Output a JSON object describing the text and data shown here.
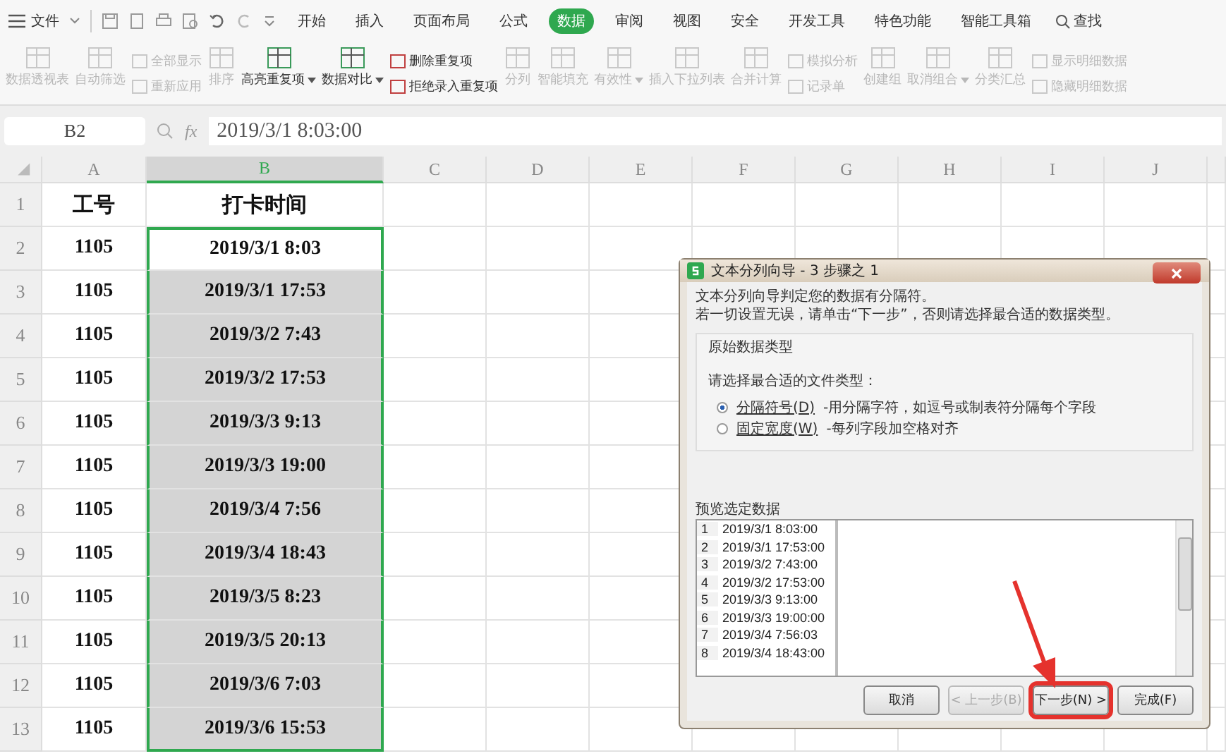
{
  "menu": {
    "file": "文件",
    "search": "查找",
    "tabs": [
      {
        "label": "开始",
        "selected": false
      },
      {
        "label": "插入",
        "selected": false
      },
      {
        "label": "页面布局",
        "selected": false
      },
      {
        "label": "公式",
        "selected": false
      },
      {
        "label": "数据",
        "selected": true
      },
      {
        "label": "审阅",
        "selected": false
      },
      {
        "label": "视图",
        "selected": false
      },
      {
        "label": "安全",
        "selected": false
      },
      {
        "label": "开发工具",
        "selected": false
      },
      {
        "label": "特色功能",
        "selected": false
      },
      {
        "label": "智能工具箱",
        "selected": false
      }
    ]
  },
  "ribbon": [
    {
      "kind": "big",
      "label": "数据透视表",
      "disabled": true,
      "dropdown": false
    },
    {
      "kind": "big",
      "label": "自动筛选",
      "disabled": true,
      "dropdown": false
    },
    {
      "kind": "small",
      "labels": [
        "全部显示",
        "重新应用"
      ],
      "disabled": true
    },
    {
      "kind": "big",
      "label": "排序",
      "disabled": true,
      "dropdown": false
    },
    {
      "kind": "big",
      "label": "高亮重复项",
      "disabled": false,
      "dropdown": true
    },
    {
      "kind": "big",
      "label": "数据对比",
      "disabled": false,
      "dropdown": true
    },
    {
      "kind": "small",
      "labels": [
        "删除重复项",
        "拒绝录入重复项"
      ],
      "disabled": false
    },
    {
      "kind": "big",
      "label": "分列",
      "disabled": true,
      "dropdown": false
    },
    {
      "kind": "big",
      "label": "智能填充",
      "disabled": true,
      "dropdown": false
    },
    {
      "kind": "big",
      "label": "有效性",
      "disabled": true,
      "dropdown": true
    },
    {
      "kind": "big",
      "label": "插入下拉列表",
      "disabled": true,
      "dropdown": false
    },
    {
      "kind": "big",
      "label": "合并计算",
      "disabled": true,
      "dropdown": false
    },
    {
      "kind": "small",
      "labels": [
        "模拟分析",
        "记录单"
      ],
      "disabled": true
    },
    {
      "kind": "big",
      "label": "创建组",
      "disabled": true,
      "dropdown": false
    },
    {
      "kind": "big",
      "label": "取消组合",
      "disabled": true,
      "dropdown": true
    },
    {
      "kind": "big",
      "label": "分类汇总",
      "disabled": true,
      "dropdown": false
    },
    {
      "kind": "small",
      "labels": [
        "显示明细数据",
        "隐藏明细数据"
      ],
      "disabled": true
    }
  ],
  "formula_bar": {
    "name_box": "B2",
    "fx_label": "fx",
    "value": "2019/3/1 8:03:00"
  },
  "sheet": {
    "columns": [
      {
        "label": "A",
        "selected": false
      },
      {
        "label": "B",
        "selected": true
      },
      {
        "label": "C",
        "selected": false
      },
      {
        "label": "D",
        "selected": false
      },
      {
        "label": "E",
        "selected": false
      },
      {
        "label": "F",
        "selected": false
      },
      {
        "label": "G",
        "selected": false
      },
      {
        "label": "H",
        "selected": false
      },
      {
        "label": "I",
        "selected": false
      },
      {
        "label": "J",
        "selected": false
      }
    ],
    "rows": [
      {
        "number": "1",
        "cells": [
          "工号",
          "打卡时间"
        ],
        "header": true,
        "selected": false,
        "active": false
      },
      {
        "number": "2",
        "cells": [
          "1105",
          "2019/3/1 8:03"
        ],
        "header": false,
        "selected": true,
        "active": true
      },
      {
        "number": "3",
        "cells": [
          "1105",
          "2019/3/1 17:53"
        ],
        "header": false,
        "selected": true,
        "active": false
      },
      {
        "number": "4",
        "cells": [
          "1105",
          "2019/3/2 7:43"
        ],
        "header": false,
        "selected": true,
        "active": false
      },
      {
        "number": "5",
        "cells": [
          "1105",
          "2019/3/2 17:53"
        ],
        "header": false,
        "selected": true,
        "active": false
      },
      {
        "number": "6",
        "cells": [
          "1105",
          "2019/3/3 9:13"
        ],
        "header": false,
        "selected": true,
        "active": false
      },
      {
        "number": "7",
        "cells": [
          "1105",
          "2019/3/3 19:00"
        ],
        "header": false,
        "selected": true,
        "active": false
      },
      {
        "number": "8",
        "cells": [
          "1105",
          "2019/3/4 7:56"
        ],
        "header": false,
        "selected": true,
        "active": false
      },
      {
        "number": "9",
        "cells": [
          "1105",
          "2019/3/4 18:43"
        ],
        "header": false,
        "selected": true,
        "active": false
      },
      {
        "number": "10",
        "cells": [
          "1105",
          "2019/3/5 8:23"
        ],
        "header": false,
        "selected": true,
        "active": false
      },
      {
        "number": "11",
        "cells": [
          "1105",
          "2019/3/5 20:13"
        ],
        "header": false,
        "selected": true,
        "active": false
      },
      {
        "number": "12",
        "cells": [
          "1105",
          "2019/3/6 7:03"
        ],
        "header": false,
        "selected": true,
        "active": false
      },
      {
        "number": "13",
        "cells": [
          "1105",
          "2019/3/6 15:53"
        ],
        "header": false,
        "selected": true,
        "active": false
      }
    ]
  },
  "dialog": {
    "title": "文本分列向导 - 3 步骤之 1",
    "intro": [
      "文本分列向导判定您的数据有分隔符。",
      "若一切设置无误，请单击“下一步”，否则请选择最合适的数据类型。"
    ],
    "group_title": "原始数据类型",
    "prompt": "请选择最合适的文件类型：",
    "options": [
      {
        "label": "分隔符号(D)",
        "description": "-用分隔字符，如逗号或制表符分隔每个字段",
        "selected": true
      },
      {
        "label": "固定宽度(W)",
        "description": "-每列字段加空格对齐",
        "selected": false
      }
    ],
    "preview_title": "预览选定数据",
    "preview_rows": [
      {
        "number": "1",
        "text": "2019/3/1 8:03:00"
      },
      {
        "number": "2",
        "text": "2019/3/1 17:53:00"
      },
      {
        "number": "3",
        "text": "2019/3/2 7:43:00"
      },
      {
        "number": "4",
        "text": "2019/3/2 17:53:00"
      },
      {
        "number": "5",
        "text": "2019/3/3 9:13:00"
      },
      {
        "number": "6",
        "text": "2019/3/3 19:00:00"
      },
      {
        "number": "7",
        "text": "2019/3/4 7:56:03"
      },
      {
        "number": "8",
        "text": "2019/3/4 18:43:00"
      }
    ],
    "buttons": [
      {
        "label": "取消",
        "disabled": false,
        "highlighted": false
      },
      {
        "label": "< 上一步(B)",
        "disabled": true,
        "highlighted": false
      },
      {
        "label": "下一步(N) >",
        "disabled": false,
        "highlighted": true
      },
      {
        "label": "完成(F)",
        "disabled": false,
        "highlighted": false
      }
    ]
  }
}
